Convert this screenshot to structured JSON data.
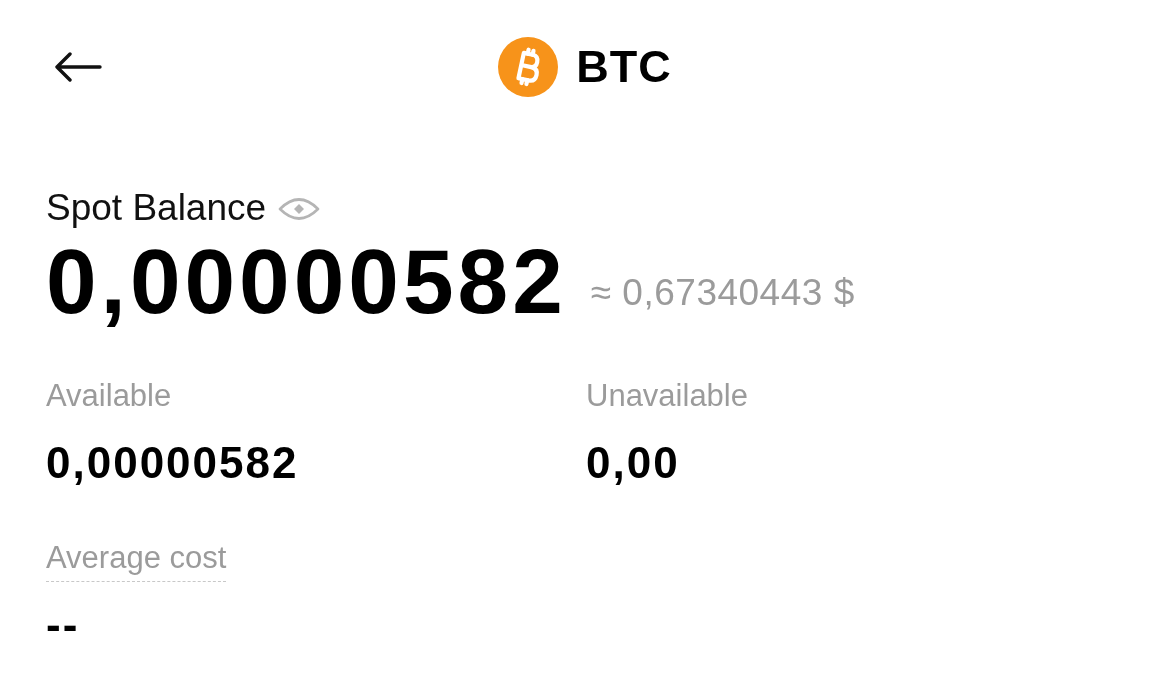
{
  "header": {
    "title": "BTC"
  },
  "balance": {
    "label": "Spot Balance",
    "amount": "0,00000582",
    "approx": "≈ 0,67340443 $"
  },
  "stats": [
    {
      "kind": "plain",
      "label": "Available",
      "value": "0,00000582"
    },
    {
      "kind": "plain",
      "label": "Unavailable",
      "value": "0,00"
    },
    {
      "kind": "hint",
      "label": "Average cost",
      "value": "--"
    }
  ]
}
